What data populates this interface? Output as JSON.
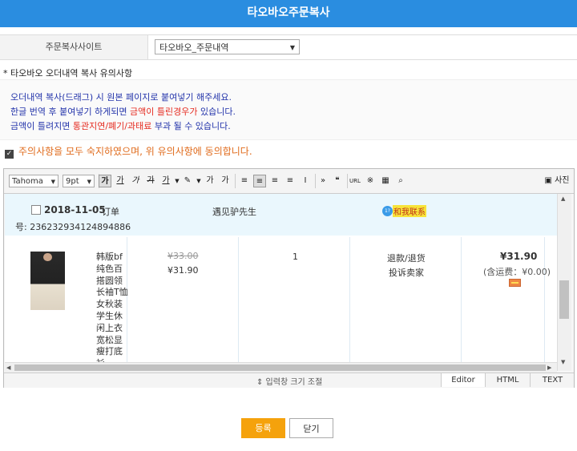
{
  "title": "타오바오주문복사",
  "site": {
    "label": "주문복사사이트",
    "selected": "타오바오_주문내역"
  },
  "notice": {
    "heading": "* 타오바오 오더내역 복사 유의사항",
    "line1": "오더내역 복사(드래그) 시 원본 페이지로 붙여넣기 해주세요.",
    "line2_a": "한글 번역 후 붙여넣기 하게되면 ",
    "line2_b": "금액이 틀린경우가",
    "line2_c": " 있습니다.",
    "line3_a": "금액이 틀려지면 ",
    "line3_b": "통관지연/폐기/과태료",
    "line3_c": " 부과 될 수 있습니다."
  },
  "agree": {
    "label": "주의사항을 모두 숙지하였으며, 위 유의사항에 동의합니다."
  },
  "toolbar": {
    "font": "Tahoma",
    "size": "9pt",
    "bold": "가",
    "underline": "가",
    "italic": "가",
    "strike": "가",
    "color": "가",
    "bg": "가",
    "sup": "가",
    "sub": "가",
    "quote": "❝",
    "url": "URL",
    "special": "※",
    "more": "»",
    "photo": "사진"
  },
  "order": {
    "date": "2018-11-05",
    "order_label": "订单",
    "order_no": "号: 236232934124894886",
    "seller": "遇见驴先生",
    "chat": "和我联系",
    "item_title": "韩版bf纯色百搭圆领长袖T恤女秋装学生休闲上衣宽松显瘦打底衫",
    "price_old": "¥33.00",
    "price_new": "¥31.90",
    "qty": "1",
    "action1": "退款/退货",
    "action2": "投诉卖家",
    "total": "¥31.90",
    "shipping": "(含运费：¥0.00)"
  },
  "editor": {
    "resize": "⇕ 입력창 크기 조절",
    "tabs": [
      "Editor",
      "HTML",
      "TEXT"
    ]
  },
  "buttons": {
    "submit": "등록",
    "close": "닫기"
  }
}
